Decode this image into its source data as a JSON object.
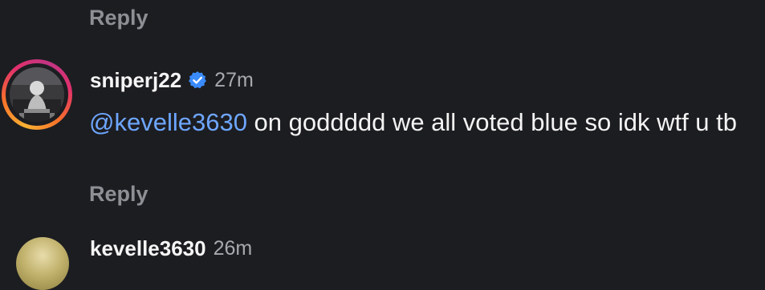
{
  "thread": {
    "top_reply_label": "Reply",
    "comment": {
      "username": "sniperj22",
      "verified_icon": "verified-badge-icon",
      "time": "27m",
      "mention": "@kevelle3630",
      "text": " on goddddd we all voted blue so idk wtf u tb",
      "reply_label": "Reply",
      "avatar_ring_colors": [
        "#f9b233",
        "#f7702a",
        "#e1306c",
        "#c13584"
      ]
    },
    "next_comment": {
      "username": "kevelle3630",
      "time": "26m"
    }
  },
  "colors": {
    "background": "#1c1d21",
    "mention": "#6ea6ff",
    "verified": "#3a8bff",
    "muted": "#8e8f95"
  }
}
